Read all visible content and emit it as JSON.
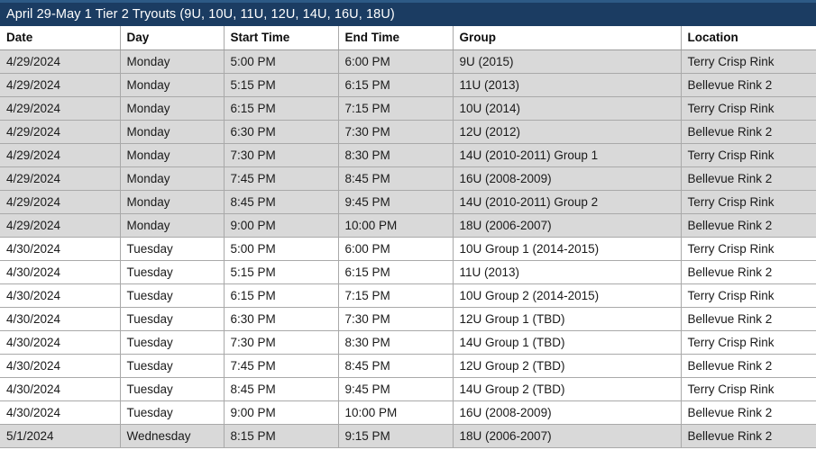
{
  "title_bar": {
    "text": "April 29-May 1 Tier 2 Tryouts (9U, 10U, 11U, 12U, 14U, 16U, 18U)",
    "background_color": "#1b3c62",
    "text_color": "#ffffff"
  },
  "table": {
    "columns": [
      {
        "key": "date",
        "label": "Date"
      },
      {
        "key": "day",
        "label": "Day"
      },
      {
        "key": "start",
        "label": "Start Time"
      },
      {
        "key": "end",
        "label": "End Time"
      },
      {
        "key": "group",
        "label": "Group"
      },
      {
        "key": "location",
        "label": "Location"
      }
    ],
    "shaded_row_color": "#d9d9d9",
    "plain_row_color": "#ffffff",
    "gridline_color": "#a9a9a9",
    "rows": [
      {
        "date": "4/29/2024",
        "day": "Monday",
        "start": "5:00 PM",
        "end": "6:00 PM",
        "group": "9U (2015)",
        "location": "Terry Crisp Rink",
        "band": "shaded"
      },
      {
        "date": "4/29/2024",
        "day": "Monday",
        "start": "5:15 PM",
        "end": "6:15 PM",
        "group": "11U (2013)",
        "location": "Bellevue Rink 2",
        "band": "shaded"
      },
      {
        "date": "4/29/2024",
        "day": "Monday",
        "start": "6:15 PM",
        "end": "7:15 PM",
        "group": "10U (2014)",
        "location": "Terry Crisp Rink",
        "band": "shaded"
      },
      {
        "date": "4/29/2024",
        "day": "Monday",
        "start": "6:30 PM",
        "end": "7:30 PM",
        "group": "12U (2012)",
        "location": "Bellevue Rink 2",
        "band": "shaded"
      },
      {
        "date": "4/29/2024",
        "day": "Monday",
        "start": "7:30 PM",
        "end": "8:30 PM",
        "group": "14U (2010-2011) Group 1",
        "location": "Terry Crisp Rink",
        "band": "shaded"
      },
      {
        "date": "4/29/2024",
        "day": "Monday",
        "start": "7:45 PM",
        "end": "8:45 PM",
        "group": "16U (2008-2009)",
        "location": "Bellevue Rink 2",
        "band": "shaded"
      },
      {
        "date": "4/29/2024",
        "day": "Monday",
        "start": "8:45 PM",
        "end": "9:45 PM",
        "group": "14U (2010-2011) Group 2",
        "location": "Terry Crisp Rink",
        "band": "shaded"
      },
      {
        "date": "4/29/2024",
        "day": "Monday",
        "start": "9:00 PM",
        "end": "10:00 PM",
        "group": "18U (2006-2007)",
        "location": "Bellevue Rink 2",
        "band": "shaded"
      },
      {
        "date": "4/30/2024",
        "day": "Tuesday",
        "start": "5:00 PM",
        "end": "6:00 PM",
        "group": "10U Group 1 (2014-2015)",
        "location": "Terry Crisp Rink",
        "band": "plain"
      },
      {
        "date": "4/30/2024",
        "day": "Tuesday",
        "start": "5:15 PM",
        "end": "6:15 PM",
        "group": "11U (2013)",
        "location": "Bellevue Rink 2",
        "band": "plain"
      },
      {
        "date": "4/30/2024",
        "day": "Tuesday",
        "start": "6:15 PM",
        "end": "7:15 PM",
        "group": "10U Group 2 (2014-2015)",
        "location": "Terry Crisp Rink",
        "band": "plain"
      },
      {
        "date": "4/30/2024",
        "day": "Tuesday",
        "start": "6:30 PM",
        "end": "7:30 PM",
        "group": "12U Group 1 (TBD)",
        "location": "Bellevue Rink 2",
        "band": "plain"
      },
      {
        "date": "4/30/2024",
        "day": "Tuesday",
        "start": "7:30 PM",
        "end": "8:30 PM",
        "group": "14U Group 1 (TBD)",
        "location": "Terry Crisp Rink",
        "band": "plain"
      },
      {
        "date": "4/30/2024",
        "day": "Tuesday",
        "start": "7:45 PM",
        "end": "8:45 PM",
        "group": "12U Group 2 (TBD)",
        "location": "Bellevue Rink 2",
        "band": "plain"
      },
      {
        "date": "4/30/2024",
        "day": "Tuesday",
        "start": "8:45 PM",
        "end": "9:45 PM",
        "group": "14U Group 2 (TBD)",
        "location": "Terry Crisp Rink",
        "band": "plain"
      },
      {
        "date": "4/30/2024",
        "day": "Tuesday",
        "start": "9:00 PM",
        "end": "10:00 PM",
        "group": "16U (2008-2009)",
        "location": "Bellevue Rink 2",
        "band": "plain"
      },
      {
        "date": "5/1/2024",
        "day": "Wednesday",
        "start": "8:15 PM",
        "end": "9:15 PM",
        "group": "18U (2006-2007)",
        "location": "Bellevue Rink 2",
        "band": "shaded"
      }
    ]
  }
}
